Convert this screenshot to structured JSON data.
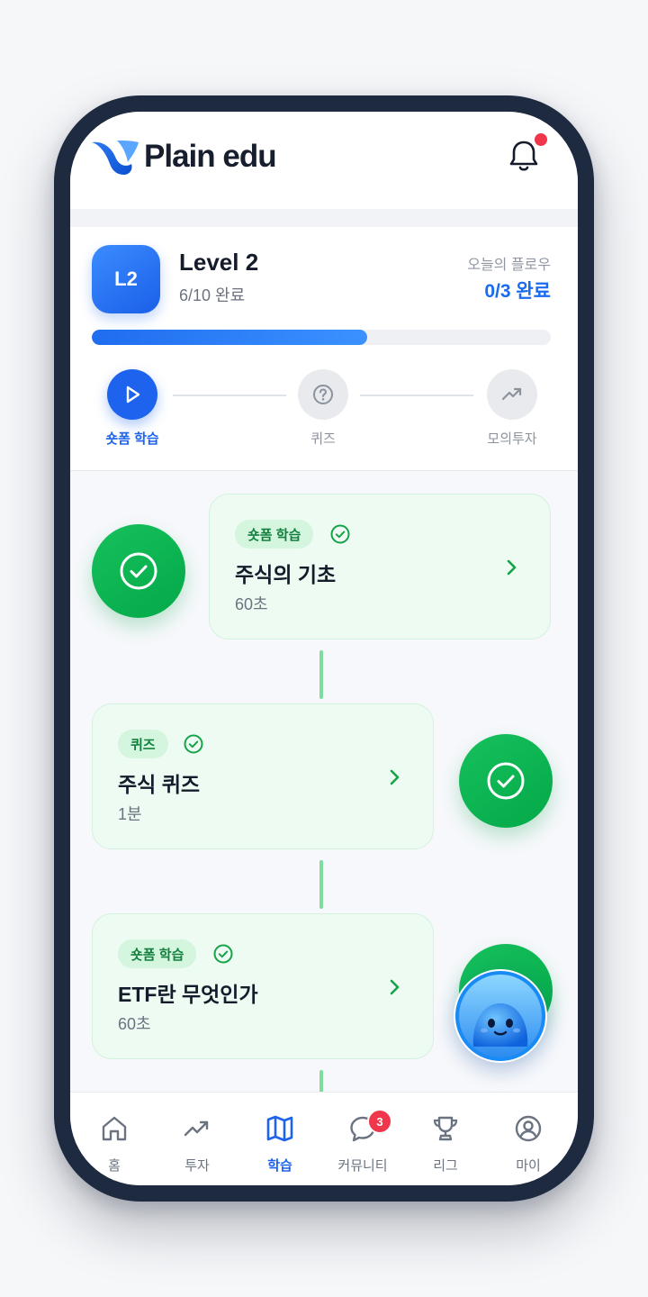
{
  "app": {
    "name": "Plain edu"
  },
  "level": {
    "badge": "L2",
    "title": "Level 2",
    "progress_text": "6/10 완료",
    "progress_fraction": 0.6,
    "today_label": "오늘의 플로우",
    "today_value": "0/3 완료"
  },
  "steps": [
    {
      "label": "숏폼 학습",
      "icon": "play-icon",
      "state": "active"
    },
    {
      "label": "퀴즈",
      "icon": "question-icon",
      "state": "inactive"
    },
    {
      "label": "모의투자",
      "icon": "trend-icon",
      "state": "inactive"
    }
  ],
  "lessons": [
    {
      "tag": "숏폼 학습",
      "title": "주식의 기초",
      "duration": "60초",
      "completed": true
    },
    {
      "tag": "퀴즈",
      "title": "주식 퀴즈",
      "duration": "1분",
      "completed": true
    },
    {
      "tag": "숏폼 학습",
      "title": "ETF란 무엇인가",
      "duration": "60초",
      "completed": true
    }
  ],
  "tabs": [
    {
      "label": "홈",
      "icon": "home-icon"
    },
    {
      "label": "투자",
      "icon": "trend-icon"
    },
    {
      "label": "학습",
      "icon": "map-icon",
      "active": true
    },
    {
      "label": "커뮤니티",
      "icon": "chat-icon",
      "badge": "3"
    },
    {
      "label": "리그",
      "icon": "trophy-icon"
    },
    {
      "label": "마이",
      "icon": "profile-icon"
    }
  ],
  "colors": {
    "accent": "#1e63ee",
    "success": "#0bb552",
    "badge": "#f0364a",
    "frame": "#1d2a40"
  }
}
